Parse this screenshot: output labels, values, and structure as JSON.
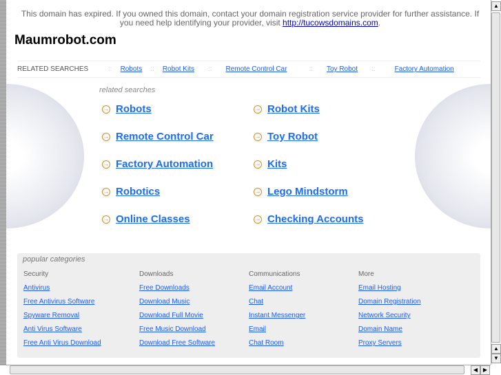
{
  "notice": {
    "text": "This domain has expired. If you owned this domain, contact your domain registration service provider for further assistance. If you need help identifying your provider, visit ",
    "link": "http://tucowsdomains.com",
    "end": "."
  },
  "domain": "Maumrobot.com",
  "related_bar": {
    "label": "RELATED SEARCHES",
    "separator": "::",
    "links": [
      "Robots",
      "Robot Kits",
      "Remote Control Car",
      "Toy Robot",
      "Factory Automation"
    ]
  },
  "related": {
    "title": "related searches",
    "links": [
      "Robots",
      "Robot Kits",
      "Remote Control Car",
      "Toy Robot",
      "Factory Automation",
      "Kits",
      "Robotics",
      "Lego Mindstorm",
      "Online Classes",
      "Checking Accounts"
    ]
  },
  "popular": {
    "title": "popular categories",
    "columns": [
      {
        "heading": "Security",
        "links": [
          "Antivirus",
          "Free Antivirus Software",
          "Spyware Removal",
          "Anti Virus Software",
          "Free Anti Virus Download"
        ]
      },
      {
        "heading": "Downloads",
        "links": [
          "Free Downloads",
          "Download Music",
          "Download Full Movie",
          "Free Music Download",
          "Download Free Software"
        ]
      },
      {
        "heading": "Communications",
        "links": [
          "Email Account",
          "Chat",
          "Instant Messenger",
          "Email",
          "Chat Room"
        ]
      },
      {
        "heading": "More",
        "links": [
          "Email Hosting",
          "Domain Registration",
          "Network Security",
          "Domain Name",
          "Proxy Servers"
        ]
      }
    ]
  }
}
